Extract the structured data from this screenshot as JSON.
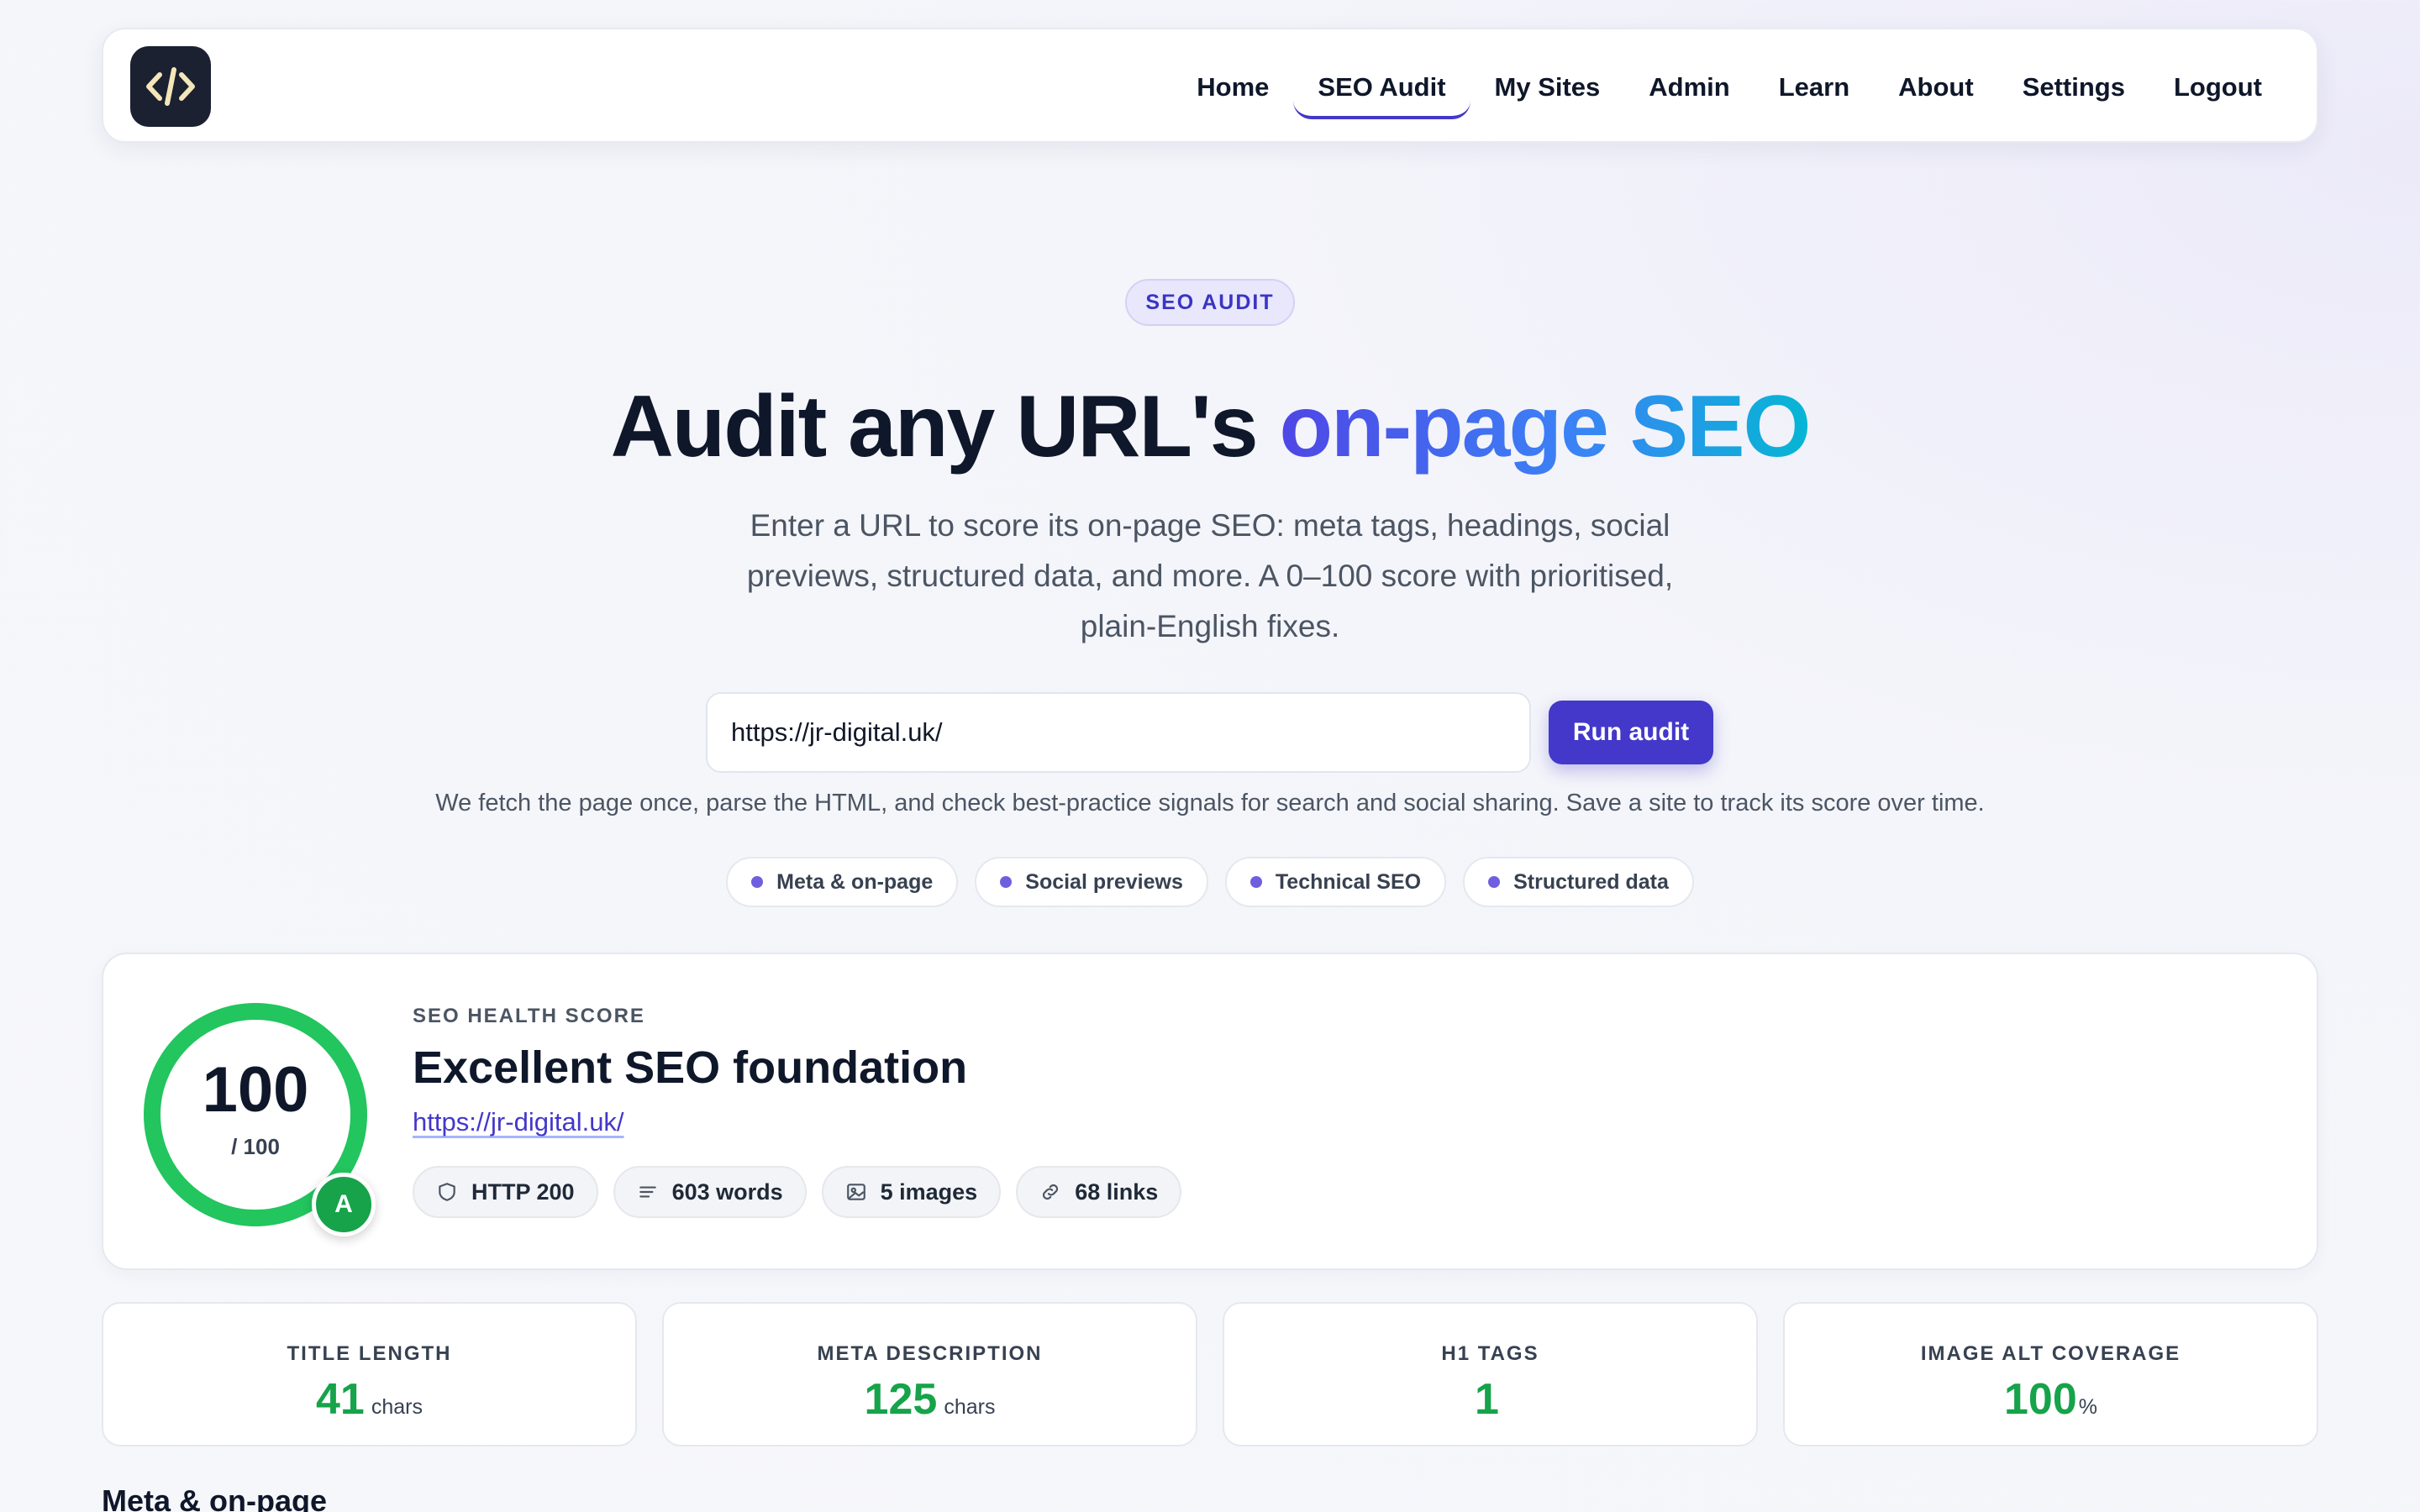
{
  "nav": {
    "logo_icon": "code-brackets-icon",
    "links": [
      "Home",
      "SEO Audit",
      "My Sites",
      "Admin",
      "Learn",
      "About",
      "Settings",
      "Logout"
    ],
    "active": "SEO Audit"
  },
  "hero": {
    "pill": "SEO AUDIT",
    "title_plain": "Audit any URL's ",
    "title_highlight": "on-page SEO",
    "subtitle": "Enter a URL to score its on-page SEO: meta tags, headings, social previews, structured data, and more. A 0–100 score with prioritised, plain-English fixes.",
    "url_value": "https://jr-digital.uk/",
    "run_button": "Run audit",
    "note": "We fetch the page once, parse the HTML, and check best-practice signals for search and social sharing. Save a site to track its score over time.",
    "chips": [
      "Meta & on-page",
      "Social previews",
      "Technical SEO",
      "Structured data"
    ]
  },
  "score": {
    "value": "100",
    "denominator": "/ 100",
    "grade": "A",
    "kicker": "SEO HEALTH SCORE",
    "title": "Excellent SEO foundation",
    "url": "https://jr-digital.uk/",
    "stats": [
      {
        "icon": "shield-icon",
        "label": "HTTP 200"
      },
      {
        "icon": "lines-icon",
        "label": "603 words"
      },
      {
        "icon": "image-icon",
        "label": "5 images"
      },
      {
        "icon": "link-icon",
        "label": "68 links"
      }
    ]
  },
  "metrics": [
    {
      "label": "TITLE LENGTH",
      "value": "41",
      "unit": "chars"
    },
    {
      "label": "META DESCRIPTION",
      "value": "125",
      "unit": "chars"
    },
    {
      "label": "H1 TAGS",
      "value": "1",
      "unit": ""
    },
    {
      "label": "IMAGE ALT COVERAGE",
      "value": "100",
      "unit": "%"
    }
  ],
  "section_heading": "Meta & on-page",
  "colors": {
    "accent": "#4338ca",
    "success": "#22c55e"
  }
}
